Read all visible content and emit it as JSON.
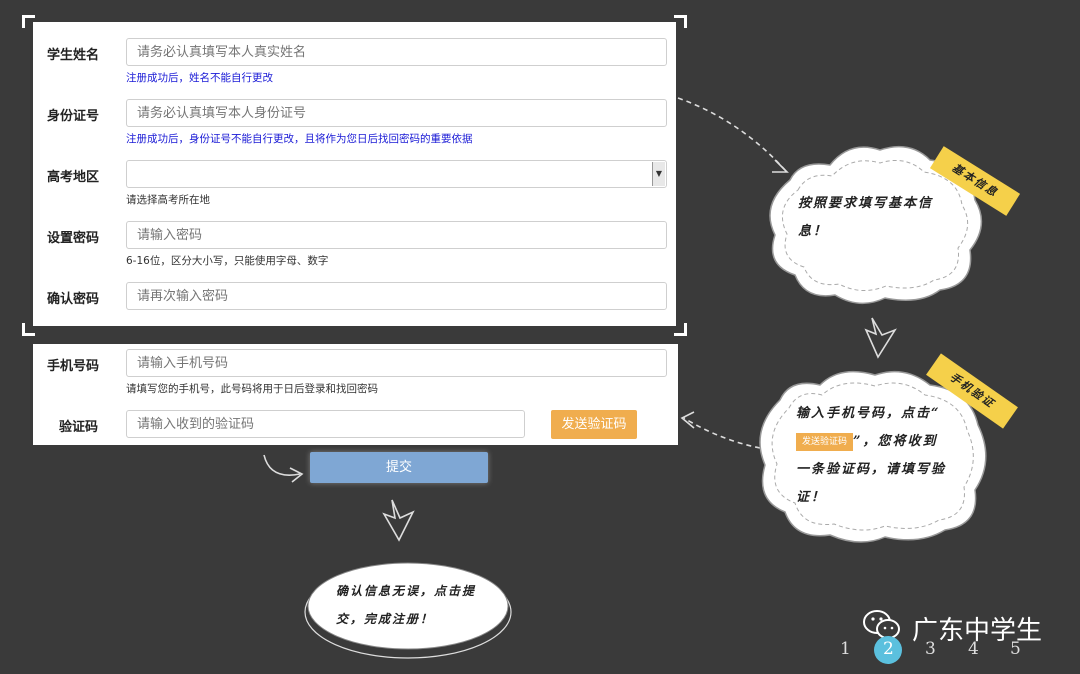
{
  "form": {
    "name": {
      "label": "学生姓名",
      "placeholder": "请务必认真填写本人真实姓名",
      "hint": "注册成功后，姓名不能自行更改"
    },
    "idcard": {
      "label": "身份证号",
      "placeholder": "请务必认真填写本人身份证号",
      "hint": "注册成功后，身份证号不能自行更改，且将作为您日后找回密码的重要依据"
    },
    "region": {
      "label": "高考地区",
      "value": "",
      "hint": "请选择高考所在地"
    },
    "password": {
      "label": "设置密码",
      "placeholder": "请输入密码",
      "hint": "6-16位，区分大小写，只能使用字母、数字"
    },
    "confirm": {
      "label": "确认密码",
      "placeholder": "请再次输入密码"
    },
    "phone": {
      "label": "手机号码",
      "placeholder": "请输入手机号码",
      "hint": "请填写您的手机号，此号码将用于日后登录和找回密码"
    },
    "code": {
      "label": "验证码",
      "placeholder": "请输入收到的验证码",
      "send_label": "发送验证码"
    },
    "submit_label": "提交"
  },
  "annotations": {
    "basic": {
      "tag": "基本信息",
      "text": "按照要求填写基本信息！"
    },
    "phone": {
      "tag": "手机验证",
      "text_before": "输入手机号码，点击“",
      "button": "发送验证码",
      "text_after": "”，您将收到一条验证码，请填写验证！"
    },
    "confirm": {
      "text": "确认信息无误，点击提交，完成注册！"
    }
  },
  "watermark": "广东中学生",
  "pager": {
    "pages": [
      "1",
      "2",
      "3",
      "4",
      "5"
    ],
    "current": 2
  },
  "colors": {
    "background": "#3a3a3a",
    "send_button": "#f0ad4e",
    "submit_button": "#7fa7d4",
    "tag": "#f5d04a",
    "hint_blue": "#1a1ad6"
  }
}
